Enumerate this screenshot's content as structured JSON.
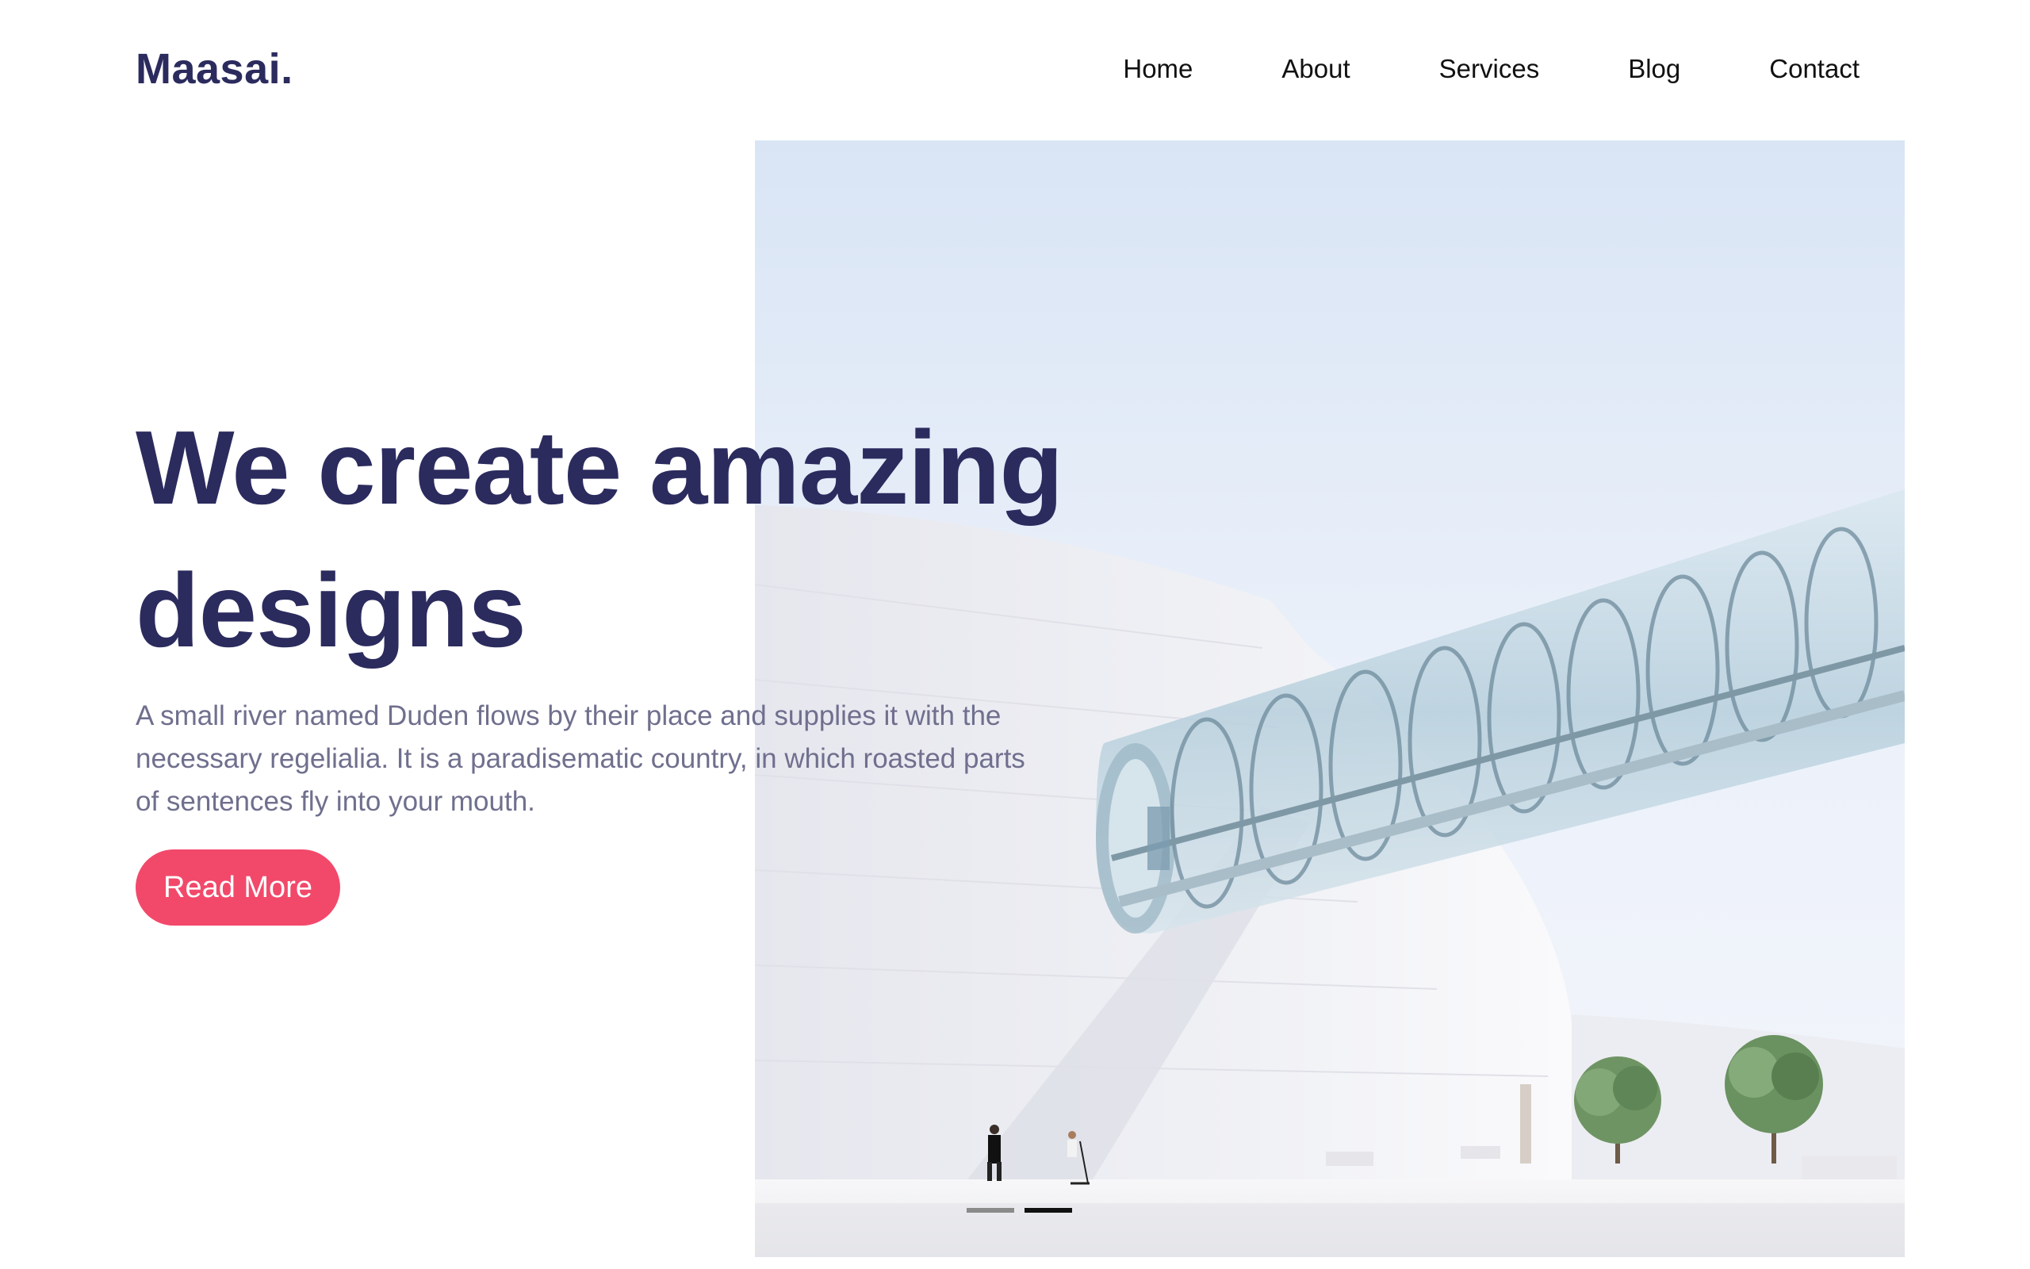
{
  "brand": {
    "name": "Maasai."
  },
  "nav": {
    "items": [
      {
        "label": "Home"
      },
      {
        "label": "About"
      },
      {
        "label": "Services"
      },
      {
        "label": "Blog"
      },
      {
        "label": "Contact"
      }
    ]
  },
  "hero": {
    "headline": "We create amazing designs",
    "subtext": "A small river named Duden flows by their place and supplies it with the necessary regelialia. It is a paradisematic country, in which roasted parts of sentences fly into your mouth.",
    "cta_label": "Read More",
    "slides": {
      "count": 2,
      "active_index": 1
    }
  },
  "colors": {
    "brand": "#2b2b5e",
    "accent": "#f2496b",
    "body_text": "#6f6f8e",
    "nav_text": "#111111"
  }
}
